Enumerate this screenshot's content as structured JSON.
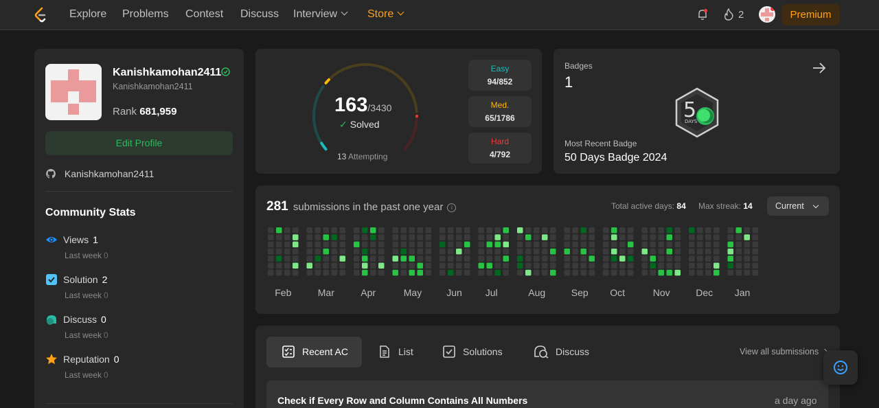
{
  "nav": {
    "links": [
      "Explore",
      "Problems",
      "Contest",
      "Discuss",
      "Interview",
      "Store"
    ],
    "streak_count": "2",
    "premium_label": "Premium"
  },
  "profile": {
    "username": "Kanishkamohan2411",
    "username_sub": "Kanishkamohan2411",
    "rank_label": "Rank",
    "rank_value": "681,959",
    "edit_label": "Edit Profile",
    "github": "Kanishkamohan2411"
  },
  "community": {
    "title": "Community Stats",
    "stats": [
      {
        "label": "Views",
        "value": "1",
        "sub": "Last week",
        "delta": "0",
        "icon": "eye-icon",
        "color": "#1a90ff"
      },
      {
        "label": "Solution",
        "value": "2",
        "sub": "Last week",
        "delta": "0",
        "icon": "solution-icon",
        "color": "#4fc3f7"
      },
      {
        "label": "Discuss",
        "value": "0",
        "sub": "Last week",
        "delta": "0",
        "icon": "discuss-icon",
        "color": "#2cbba6"
      },
      {
        "label": "Reputation",
        "value": "0",
        "sub": "Last week",
        "delta": "0",
        "icon": "star-icon",
        "color": "#ffa116"
      }
    ]
  },
  "progress": {
    "solved": "163",
    "total": "/3430",
    "solved_label": "Solved",
    "attempting_count": "13",
    "attempting_label": "Attempting",
    "easy": {
      "label": "Easy",
      "count": "94/852",
      "color": "#1cbaba"
    },
    "medium": {
      "label": "Med.",
      "count": "65/1786",
      "color": "#ffb700"
    },
    "hard": {
      "label": "Hard",
      "count": "4/792",
      "color": "#f63737"
    }
  },
  "badges": {
    "label": "Badges",
    "count": "1",
    "badge_text": "DAYS",
    "recent_label": "Most Recent Badge",
    "recent_name": "50 Days Badge 2024"
  },
  "submissions": {
    "count": "281",
    "title_suffix": "submissions in the past one year",
    "info_icon": "i",
    "active_days_label": "Total active days:",
    "active_days": "84",
    "max_streak_label": "Max streak:",
    "max_streak": "14",
    "range_select": "Current",
    "months": [
      "Feb",
      "Mar",
      "Apr",
      "May",
      "Jun",
      "Jul",
      "Aug",
      "Sep",
      "Oct",
      "Nov",
      "Dec",
      "Jan"
    ]
  },
  "recent": {
    "tabs": [
      "Recent AC",
      "List",
      "Solutions",
      "Discuss"
    ],
    "view_all": "View all submissions",
    "items": [
      {
        "title": "Check if Every Row and Column Contains All Numbers",
        "time": "a day ago"
      }
    ]
  },
  "colors": {
    "accent": "#ffa116",
    "green": "#2cbb5d"
  }
}
